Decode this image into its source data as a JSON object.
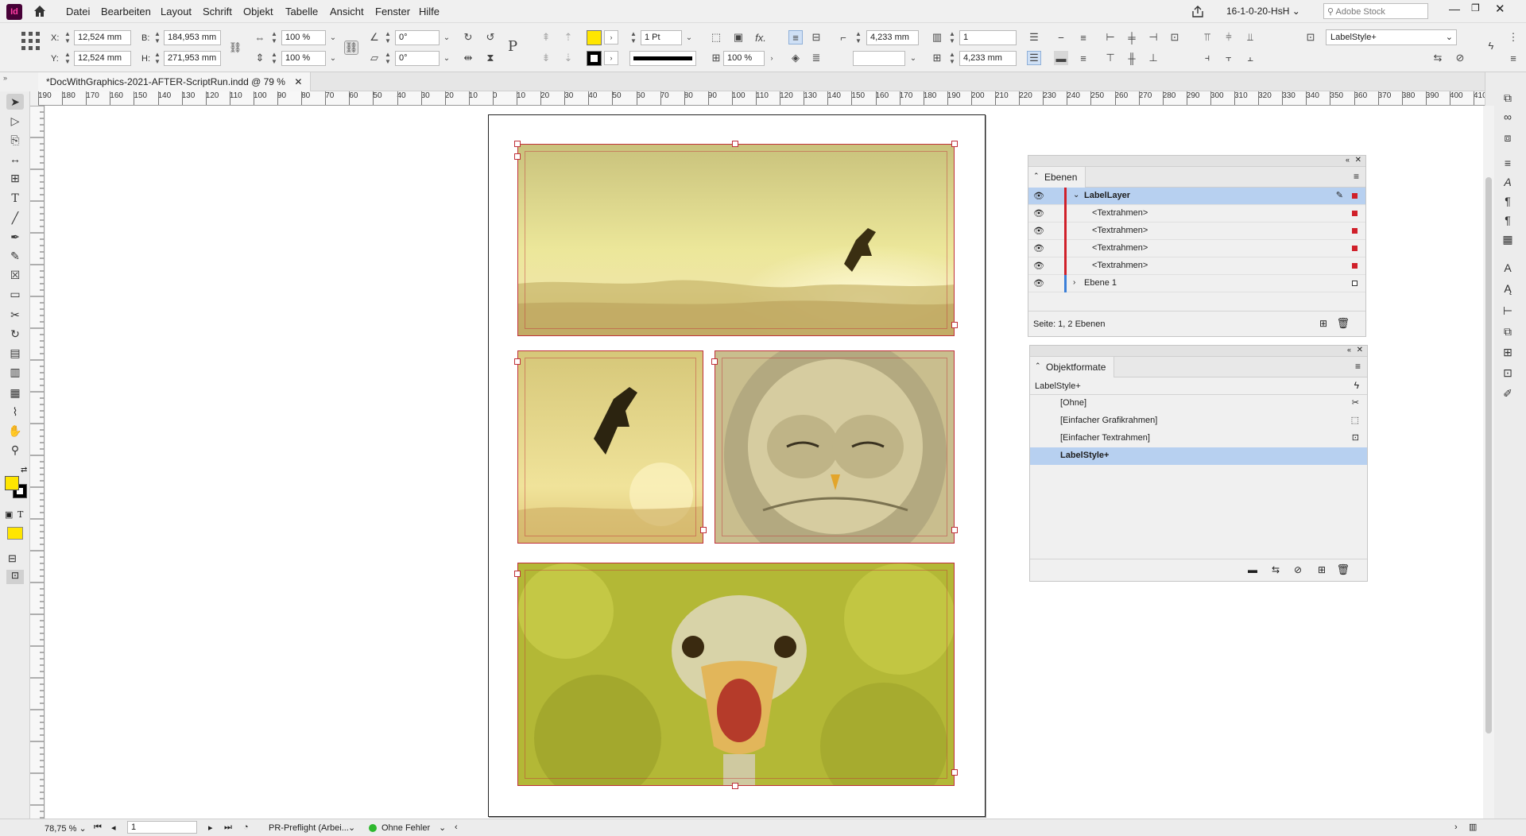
{
  "app": {
    "logo": "Id",
    "workspace": "16-1-0-20-HsH",
    "search_placeholder": "Adobe Stock"
  },
  "menu": [
    "Datei",
    "Bearbeiten",
    "Layout",
    "Schrift",
    "Objekt",
    "Tabelle",
    "Ansicht",
    "Fenster",
    "Hilfe"
  ],
  "control": {
    "x_label": "X:",
    "x_value": "12,524 mm",
    "y_label": "Y:",
    "y_value": "12,524 mm",
    "w_label": "B:",
    "w_value": "184,953 mm",
    "h_label": "H:",
    "h_value": "271,953 mm",
    "scale_x": "100 %",
    "scale_y": "100 %",
    "rotate": "0°",
    "shear": "0°",
    "stroke_weight": "1 Pt",
    "opacity": "100 %",
    "offset_1": "4,233 mm",
    "offset_2": "4,233 mm",
    "columns": "1",
    "object_style": "LabelStyle+",
    "fill_color": "#ffe600"
  },
  "document_tab": {
    "title": "*DocWithGraphics-2021-AFTER-ScriptRun.indd @ 79 %"
  },
  "ruler": {
    "h_ticks": [
      "190",
      "180",
      "170",
      "160",
      "150",
      "140",
      "130",
      "120",
      "110",
      "100",
      "90",
      "80",
      "70",
      "60",
      "50",
      "40",
      "30",
      "20",
      "10",
      "0",
      "10",
      "20",
      "30",
      "40",
      "50",
      "60",
      "70",
      "80",
      "90",
      "100",
      "110",
      "120",
      "130",
      "140",
      "150",
      "160",
      "170",
      "180",
      "190",
      "200",
      "210",
      "220",
      "230",
      "240",
      "250",
      "260",
      "270",
      "280",
      "290",
      "300",
      "310",
      "320",
      "330",
      "340",
      "350",
      "360",
      "370",
      "380",
      "390",
      "400",
      "410"
    ]
  },
  "layers_panel": {
    "title": "Ebenen",
    "rows": [
      {
        "name": "LabelLayer",
        "level": 0,
        "expanded": true,
        "selected": true,
        "color": "#d0202a"
      },
      {
        "name": "<Textrahmen>",
        "level": 1,
        "selected": false,
        "color": "#d0202a"
      },
      {
        "name": "<Textrahmen>",
        "level": 1,
        "selected": false,
        "color": "#d0202a"
      },
      {
        "name": "<Textrahmen>",
        "level": 1,
        "selected": false,
        "color": "#d0202a"
      },
      {
        "name": "<Textrahmen>",
        "level": 1,
        "selected": false,
        "color": "#d0202a"
      },
      {
        "name": "Ebene 1",
        "level": 0,
        "expanded": false,
        "selected": false,
        "color": "#3b7fd8"
      }
    ],
    "footer": "Seite: 1, 2 Ebenen"
  },
  "object_styles_panel": {
    "title": "Objektformate",
    "current": "LabelStyle+",
    "rows": [
      {
        "name": "[Ohne]",
        "selected": false
      },
      {
        "name": "[Einfacher Grafikrahmen]",
        "selected": false
      },
      {
        "name": "[Einfacher Textrahmen]",
        "selected": false
      },
      {
        "name": "LabelStyle+",
        "selected": true
      }
    ]
  },
  "status": {
    "zoom": "78,75 %",
    "page": "1",
    "preflight_profile": "PR-Preflight (Arbei...",
    "preflight_result": "Ohne Fehler",
    "preflight_color": "#2eb82e"
  }
}
